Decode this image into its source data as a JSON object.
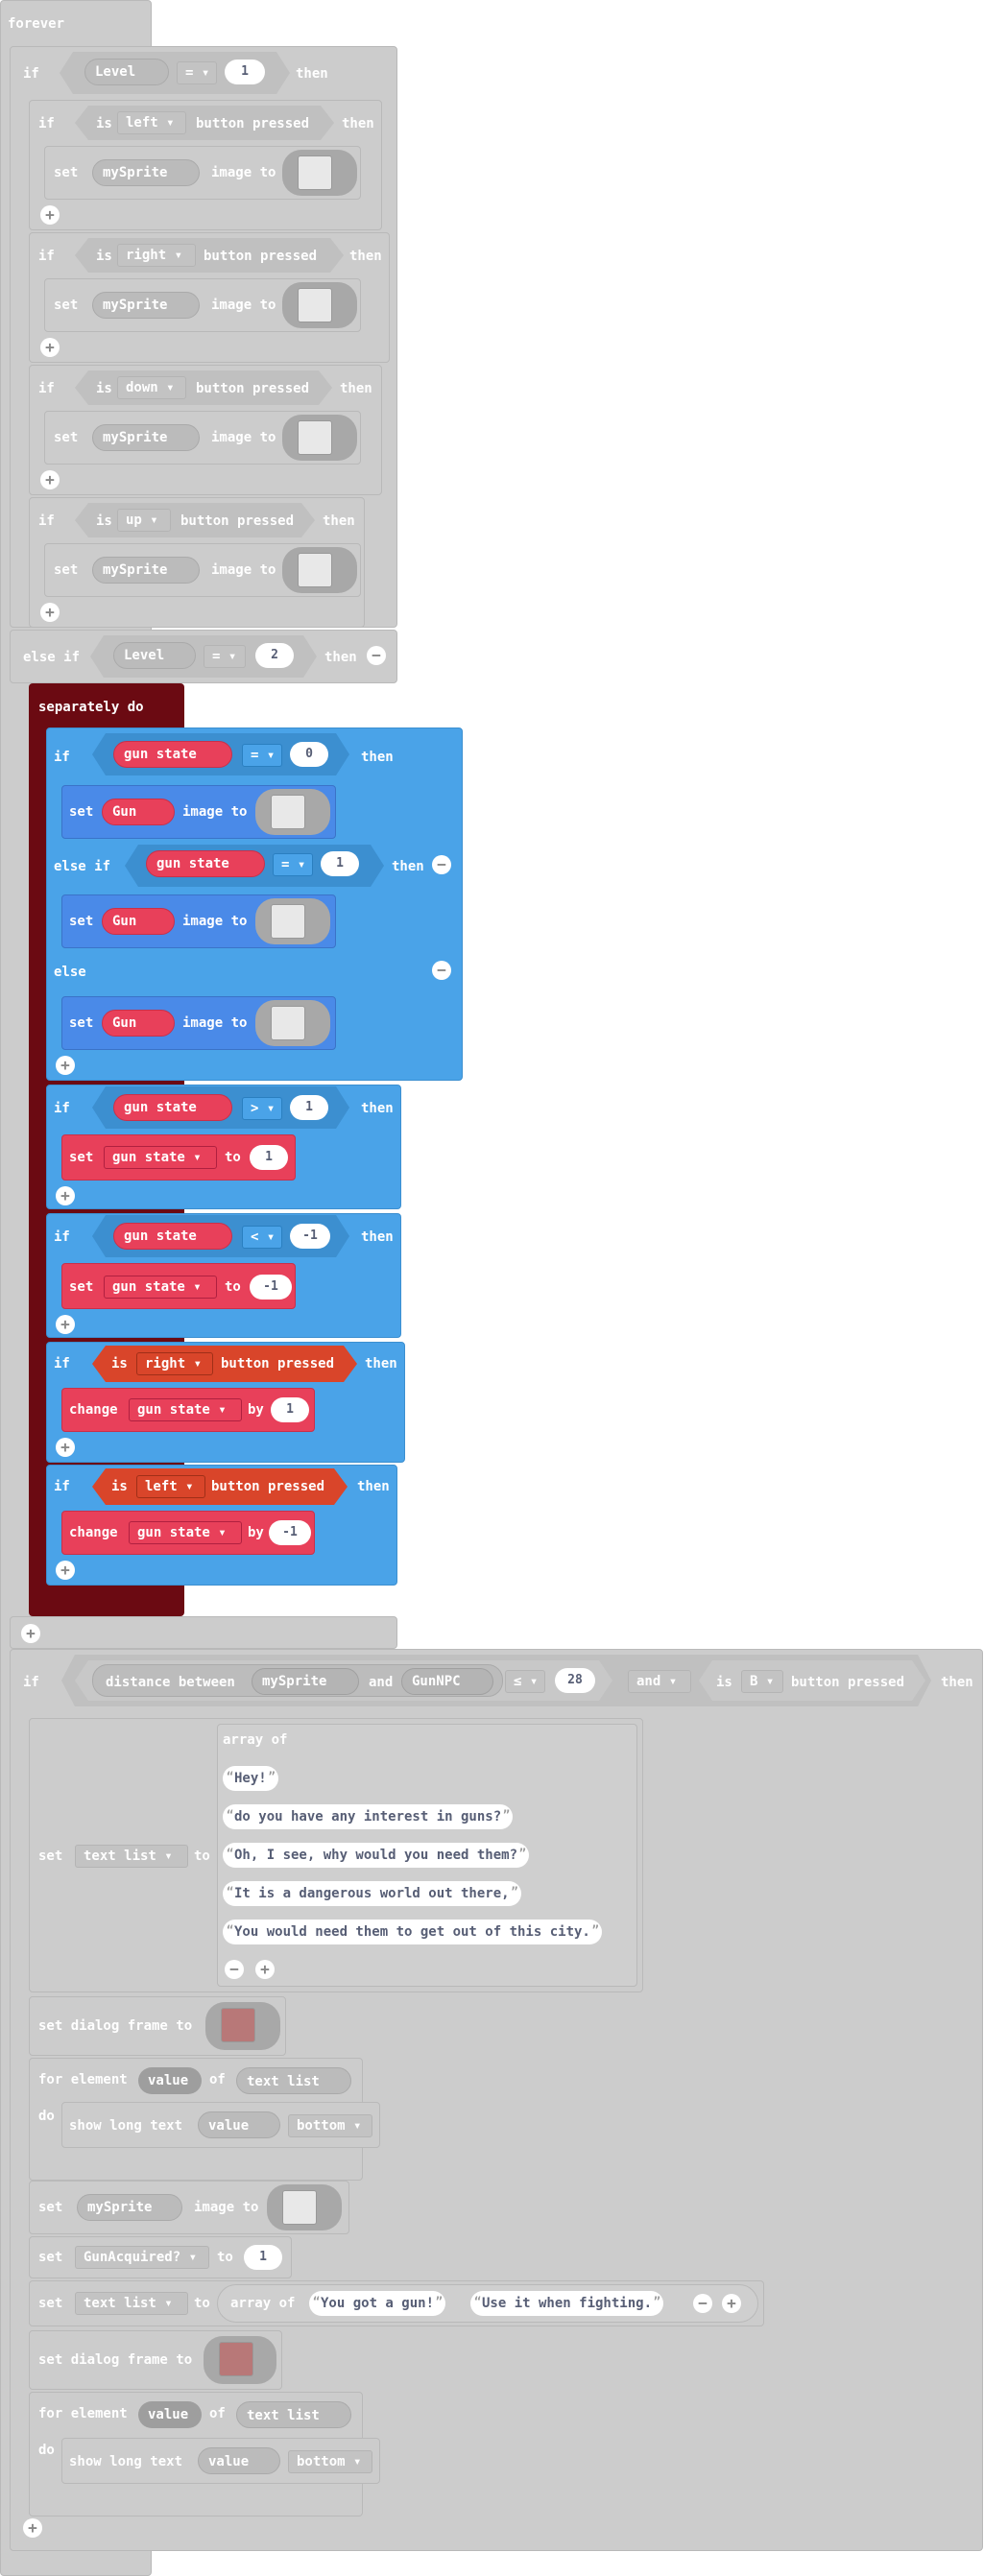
{
  "forever": "forever",
  "kw": {
    "if": "if",
    "then": "then",
    "set": "set",
    "image_to": "image to",
    "is": "is",
    "button_pressed": "button pressed",
    "else_if": "else if",
    "else": "else",
    "separately_do": "separately do",
    "to": "to",
    "change": "change",
    "by": "by",
    "distance_between": "distance between",
    "and": "and",
    "array_of": "array of",
    "set_dialog_frame_to": "set dialog frame to",
    "for_element": "for element",
    "of": "of",
    "do": "do",
    "show_long_text": "show long text"
  },
  "vars": {
    "level": "Level",
    "mysprite": "mySprite",
    "gun": "Gun",
    "gun_state": "gun state",
    "gunnpc": "GunNPC",
    "text_list": "text list",
    "value": "value",
    "gun_acquired": "GunAcquired?",
    "bottom": "bottom"
  },
  "ops": {
    "eq": "=",
    "gt": ">",
    "lt": "<",
    "le": "≤"
  },
  "buttons": {
    "left": "left",
    "right": "right",
    "down": "down",
    "up": "up",
    "b": "B"
  },
  "numbers": {
    "level1": "1",
    "level2": "2",
    "zero": "0",
    "one": "1",
    "neg_one": "-1",
    "dist": "28"
  },
  "dialog": [
    "Hey!",
    "do you have any interest in guns?",
    "Oh, I see, why would you need them?",
    "It is a dangerous world out there,",
    "You would need them to get out of this city."
  ],
  "dialog2": [
    "You got a gun!",
    "Use it when fighting."
  ],
  "icons": {
    "add": "plus-icon",
    "remove": "minus-icon",
    "dropdown": "chevron-down-icon"
  },
  "colors": {
    "grey_block": "#cccccc",
    "logic_blue": "#4aa3e8",
    "sprite_blue": "#4a8ae8",
    "variable_red": "#e8405a",
    "control_dark_red": "#6b0a12",
    "controller_orange": "#d9452a"
  }
}
